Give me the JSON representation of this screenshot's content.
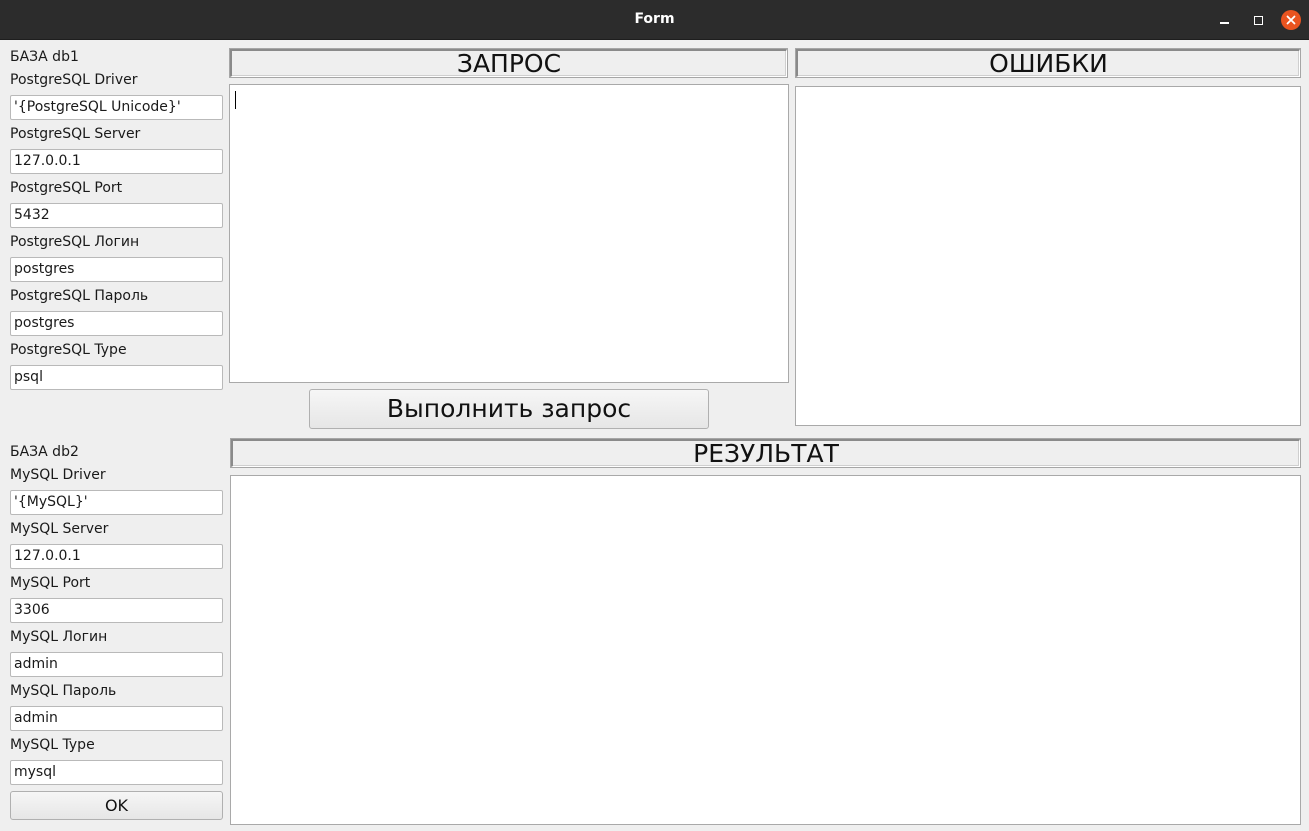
{
  "window": {
    "title": "Form",
    "close_color": "#e95420"
  },
  "db1": {
    "heading": "БАЗА db1",
    "fields": [
      {
        "label": "PostgreSQL Driver",
        "value": "'{PostgreSQL Unicode}'"
      },
      {
        "label": "PostgreSQL Server",
        "value": "127.0.0.1"
      },
      {
        "label": "PostgreSQL Port",
        "value": "5432"
      },
      {
        "label": "PostgreSQL Логин",
        "value": "postgres"
      },
      {
        "label": "PostgreSQL Пароль",
        "value": "postgres"
      },
      {
        "label": "PostgreSQL Type",
        "value": "psql"
      }
    ]
  },
  "db2": {
    "heading": "БАЗА db2",
    "fields": [
      {
        "label": "MySQL Driver",
        "value": "'{MySQL}'"
      },
      {
        "label": "MySQL Server",
        "value": "127.0.0.1"
      },
      {
        "label": "MySQL Port",
        "value": "3306"
      },
      {
        "label": "MySQL Логин",
        "value": "admin"
      },
      {
        "label": "MySQL Пароль",
        "value": "admin"
      },
      {
        "label": "MySQL Type",
        "value": "mysql"
      }
    ],
    "ok_label": "OK"
  },
  "query": {
    "header": "ЗАПРОС",
    "text": "",
    "run_label": "Выполнить запрос"
  },
  "errors": {
    "header": "ОШИБКИ",
    "text": ""
  },
  "result": {
    "header": "РЕЗУЛЬТАТ",
    "text": ""
  }
}
